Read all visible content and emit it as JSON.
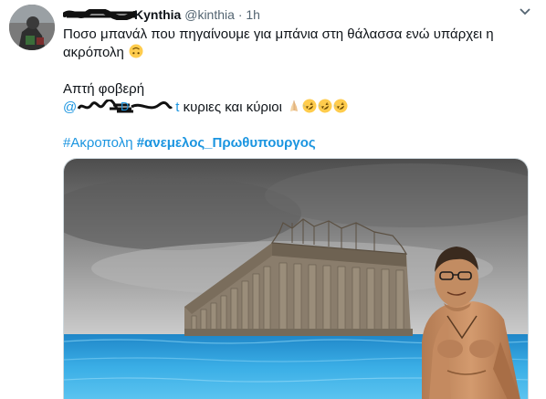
{
  "tweet": {
    "author_handle": "@kinthia",
    "separator": "·",
    "time": "1h",
    "name_visible_tail": "Kynthia",
    "line1": "Ποσο μπανάλ που πηγαίνουμε για μπάνια στη θάλασσα ενώ υπάρχει η",
    "line2": "ακρόπολη",
    "line3": "Απτή φοβερή",
    "mention_prefix": "@",
    "mention_suffix": "t",
    "line4_text": " κυριες και κύριοι",
    "hashtag1": "#Ακροπολη",
    "hashtag2": "#ανεμελος_Πρωθυπουργος",
    "icons": {
      "line2_emoji": "upside-down-face-emoji",
      "line4_emojis": [
        "folded-hands-emoji",
        "rofl-emoji",
        "rofl-emoji",
        "rofl-emoji"
      ],
      "menu": "chevron-down-icon"
    }
  },
  "colors": {
    "link": "#1b95e0",
    "muted": "#536471",
    "text": "#0f1419",
    "sea": "#2b9fd9"
  }
}
